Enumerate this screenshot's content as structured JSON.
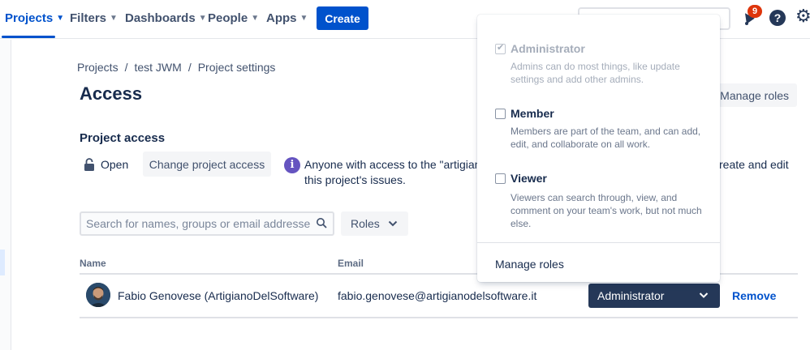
{
  "nav": {
    "items": [
      {
        "label": "Projects",
        "active": true
      },
      {
        "label": "Filters"
      },
      {
        "label": "Dashboards"
      },
      {
        "label": "People"
      },
      {
        "label": "Apps"
      }
    ],
    "create_label": "Create",
    "notification_count": "9",
    "help_glyph": "?"
  },
  "breadcrumb": {
    "items": [
      "Projects",
      "test JWM",
      "Project settings"
    ],
    "separator": "/"
  },
  "page": {
    "title": "Access",
    "manage_roles_label": "Manage roles"
  },
  "project_access": {
    "title": "Project access",
    "status": "Open",
    "change_label": "Change project access",
    "info_line1_start": "Anyone with access to the \"artigianc",
    "info_line1_end": "reate and edit",
    "info_line2": "this project's issues."
  },
  "filters": {
    "search_placeholder": "Search for names, groups or email addresses",
    "roles_label": "Roles"
  },
  "table": {
    "headers": {
      "name": "Name",
      "email": "Email"
    },
    "rows": [
      {
        "name": "Fabio Genovese (ArtigianoDelSoftware)",
        "email": "fabio.genovese@artigianodelsoftware.it",
        "role": "Administrator",
        "action": "Remove"
      }
    ]
  },
  "role_dropdown": {
    "options": [
      {
        "title": "Administrator",
        "description": "Admins can do most things, like update settings and add other admins.",
        "checked": true,
        "disabled": true
      },
      {
        "title": "Member",
        "description": "Members are part of the team, and can add, edit, and collaborate on all work.",
        "checked": false,
        "disabled": false
      },
      {
        "title": "Viewer",
        "description": "Viewers can search through, view, and comment on your team's work, but not much else.",
        "checked": false,
        "disabled": false
      }
    ],
    "footer_label": "Manage roles"
  },
  "colors": {
    "brand_blue": "#0052cc",
    "dark_select": "#253858",
    "info_purple": "#6554c0",
    "badge_red": "#de350b"
  }
}
